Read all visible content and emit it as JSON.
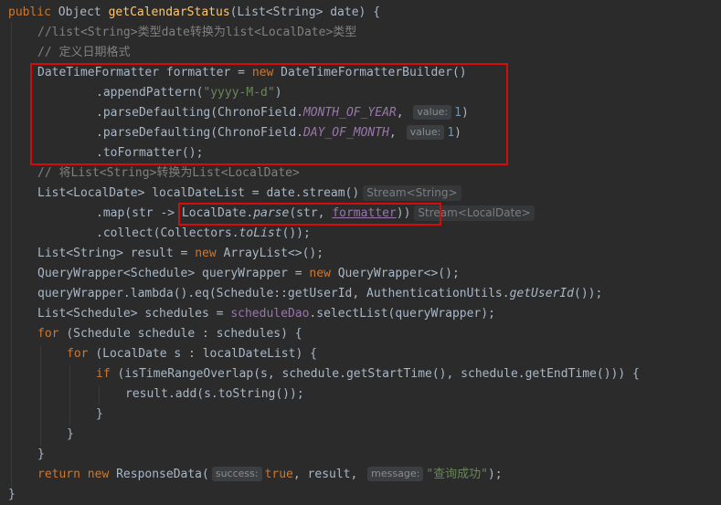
{
  "lines": [
    {
      "segments": [
        {
          "t": "public ",
          "c": "kw"
        },
        {
          "t": "Object ",
          "c": ""
        },
        {
          "t": "getCalendarStatus",
          "c": "fn"
        },
        {
          "t": "(List<String> date) {",
          "c": ""
        }
      ]
    },
    {
      "segments": [
        {
          "t": "//list<String>类型date转换为list<LocalDate>类型",
          "c": "cmt"
        }
      ]
    },
    {
      "segments": [
        {
          "t": "// 定义日期格式",
          "c": "cmt"
        }
      ]
    },
    {
      "segments": [
        {
          "t": "DateTimeFormatter formatter = ",
          "c": ""
        },
        {
          "t": "new ",
          "c": "kw"
        },
        {
          "t": "DateTimeFormatterBuilder()",
          "c": ""
        }
      ]
    },
    {
      "segments": [
        {
          "t": ".appendPattern(",
          "c": ""
        },
        {
          "t": "\"yyyy-M-d\"",
          "c": "str"
        },
        {
          "t": ")",
          "c": ""
        }
      ]
    },
    {
      "segments": [
        {
          "t": ".parseDefaulting(ChronoField.",
          "c": ""
        },
        {
          "t": "MONTH_OF_YEAR",
          "c": "cn"
        },
        {
          "t": ", ",
          "c": ""
        },
        {
          "hint": "value:"
        },
        {
          "t": "1",
          "c": "num"
        },
        {
          "t": ")",
          "c": ""
        }
      ]
    },
    {
      "segments": [
        {
          "t": ".parseDefaulting(ChronoField.",
          "c": ""
        },
        {
          "t": "DAY_OF_MONTH",
          "c": "cn"
        },
        {
          "t": ", ",
          "c": ""
        },
        {
          "hint": "value:"
        },
        {
          "t": "1",
          "c": "num"
        },
        {
          "t": ")",
          "c": ""
        }
      ]
    },
    {
      "segments": [
        {
          "t": ".toFormatter();",
          "c": ""
        }
      ]
    },
    {
      "segments": [
        {
          "t": "// 将List<String>转换为List<LocalDate>",
          "c": "cmt"
        }
      ]
    },
    {
      "segments": [
        {
          "t": "List<LocalDate> localDateList = date.stream()",
          "c": ""
        },
        {
          "hintg": "Stream<String>"
        }
      ]
    },
    {
      "segments": [
        {
          "t": ".map(str -> ",
          "c": ""
        },
        {
          "t": "LocalDate.",
          "c": ""
        },
        {
          "t": "parse",
          "c": "it"
        },
        {
          "t": "(str, ",
          "c": ""
        },
        {
          "t": "formatter",
          "c": "fieldref ul"
        },
        {
          "t": "))",
          "c": ""
        },
        {
          "hintg": "Stream<LocalDate>"
        }
      ]
    },
    {
      "segments": [
        {
          "t": ".collect(Collectors.",
          "c": ""
        },
        {
          "t": "toList",
          "c": "it"
        },
        {
          "t": "());",
          "c": ""
        }
      ]
    },
    {
      "segments": [
        {
          "t": "List<String> result = ",
          "c": ""
        },
        {
          "t": "new ",
          "c": "kw"
        },
        {
          "t": "ArrayList<>();",
          "c": ""
        }
      ]
    },
    {
      "segments": [
        {
          "t": "QueryWrapper<Schedule> queryWrapper = ",
          "c": ""
        },
        {
          "t": "new ",
          "c": "kw"
        },
        {
          "t": "QueryWrapper<>();",
          "c": ""
        }
      ]
    },
    {
      "segments": [
        {
          "t": "queryWrapper.lambda().eq(Schedule::getUserId, AuthenticationUtils.",
          "c": ""
        },
        {
          "t": "getUserId",
          "c": "it"
        },
        {
          "t": "());",
          "c": ""
        }
      ]
    },
    {
      "segments": [
        {
          "t": "List<Schedule> schedules = ",
          "c": ""
        },
        {
          "t": "scheduleDao",
          "c": "fieldref"
        },
        {
          "t": ".selectList(queryWrapper);",
          "c": ""
        }
      ]
    },
    {
      "segments": [
        {
          "t": "for ",
          "c": "kw"
        },
        {
          "t": "(Schedule schedule : schedules) {",
          "c": ""
        }
      ]
    },
    {
      "segments": [
        {
          "t": "for ",
          "c": "kw"
        },
        {
          "t": "(LocalDate s : localDateList) {",
          "c": ""
        }
      ]
    },
    {
      "segments": [
        {
          "t": "if ",
          "c": "kw"
        },
        {
          "t": "(isTimeRangeOverlap(s, schedule.getStartTime(), schedule.getEndTime())) {",
          "c": ""
        }
      ]
    },
    {
      "segments": [
        {
          "t": "result.add(s.toString());",
          "c": ""
        }
      ]
    },
    {
      "segments": [
        {
          "t": "}",
          "c": ""
        }
      ]
    },
    {
      "segments": [
        {
          "t": "}",
          "c": ""
        }
      ]
    },
    {
      "segments": [
        {
          "t": "}",
          "c": ""
        }
      ]
    },
    {
      "segments": [
        {
          "t": "return new ",
          "c": "kw"
        },
        {
          "t": "ResponseData(",
          "c": ""
        },
        {
          "hint": "success:"
        },
        {
          "t": "true",
          "c": "kw"
        },
        {
          "t": ", result, ",
          "c": ""
        },
        {
          "hint": "message:"
        },
        {
          "t": "\"查询成功\"",
          "c": "str"
        },
        {
          "t": ");",
          "c": ""
        }
      ]
    },
    {
      "segments": [
        {
          "t": "}",
          "c": ""
        }
      ]
    }
  ]
}
